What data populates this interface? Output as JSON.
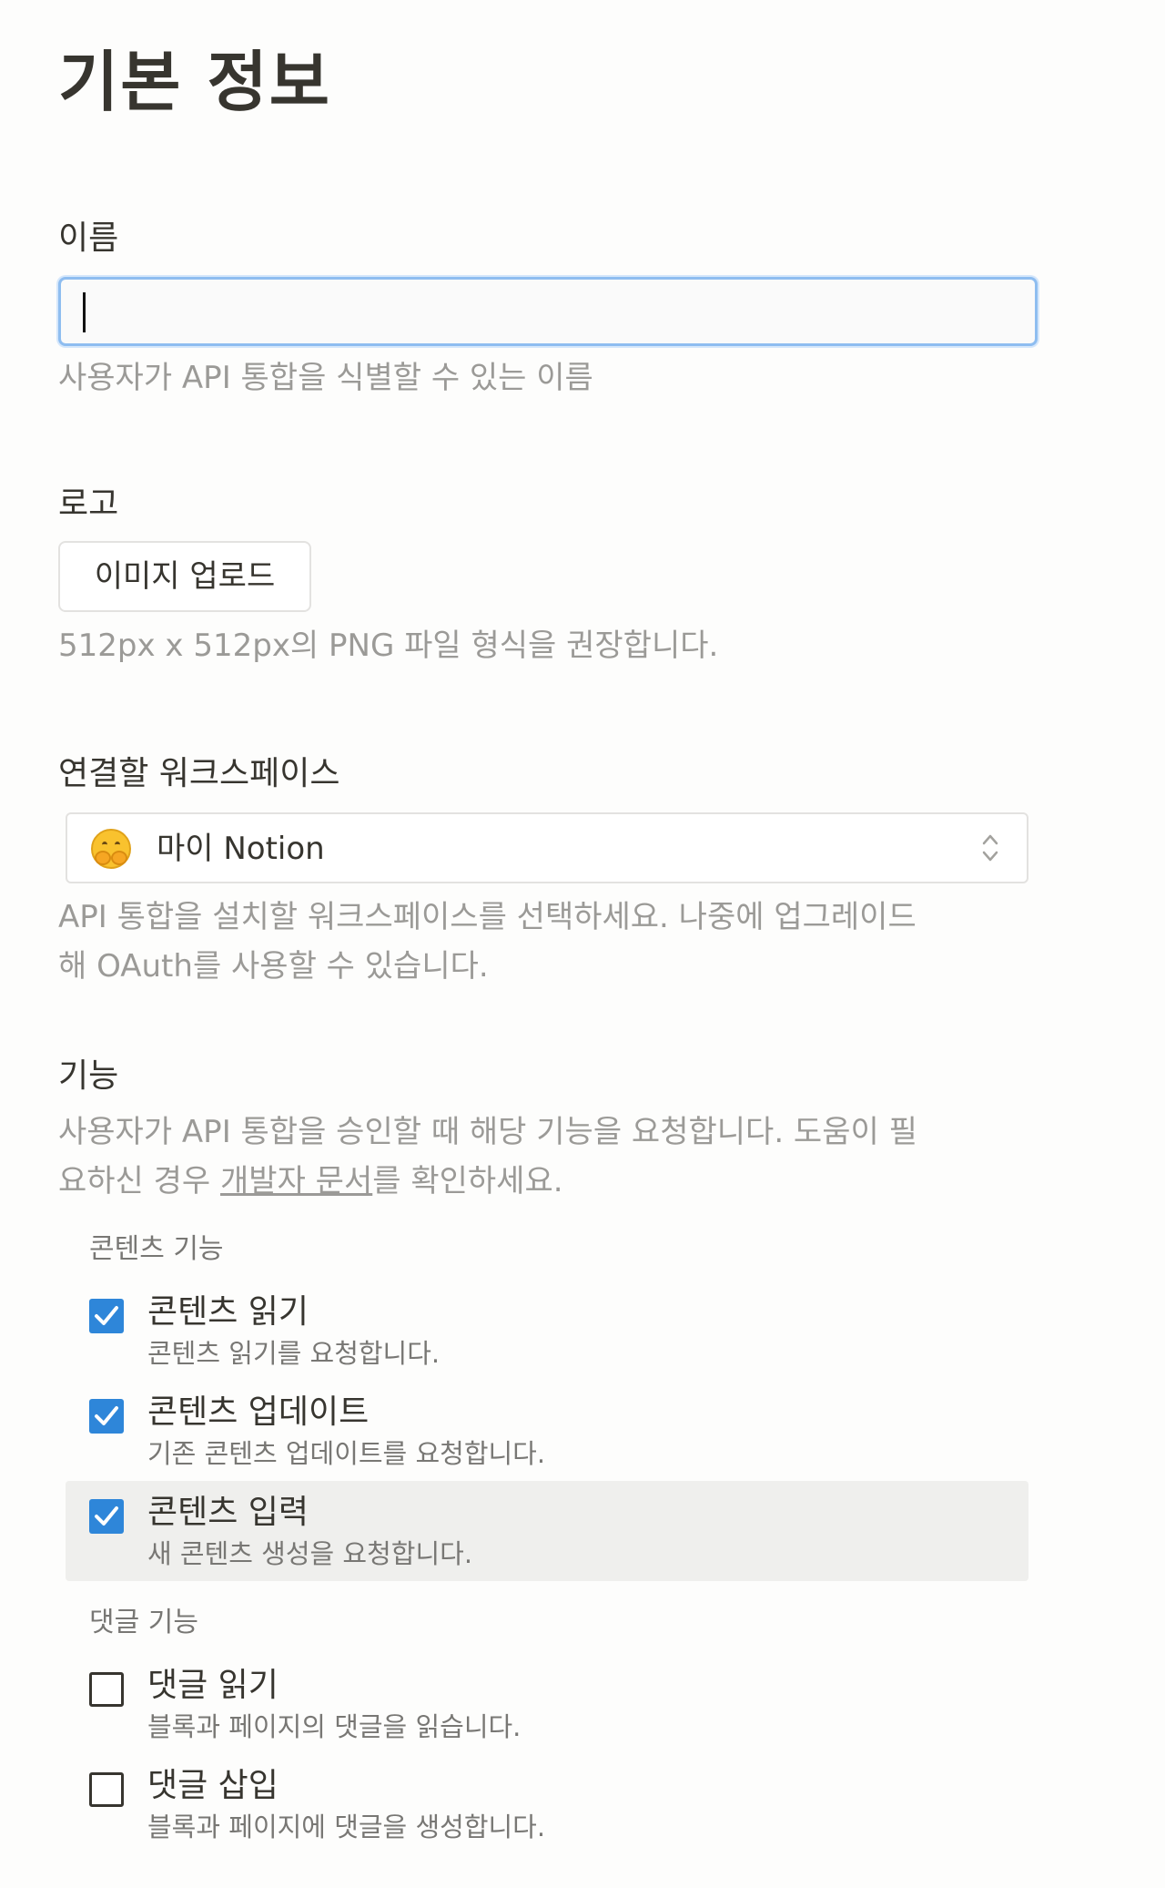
{
  "page": {
    "title": "기본 정보"
  },
  "name": {
    "label": "이름",
    "value": "",
    "help": "사용자가 API 통합을 식별할 수 있는 이름"
  },
  "logo": {
    "label": "로고",
    "upload_button": "이미지 업로드",
    "help": "512px x 512px의 PNG 파일 형식을 권장합니다."
  },
  "workspace": {
    "label": "연결할 워크스페이스",
    "icon": "hugging-face-emoji",
    "selected": "마이 Notion",
    "help_line1": "API 통합을 설치할 워크스페이스를 선택하세요. 나중에 업그레이드",
    "help_line2": "해 OAuth를 사용할 수 있습니다."
  },
  "capabilities": {
    "label": "기능",
    "help_line1": "사용자가 API 통합을 승인할 때 해당 기능을 요청합니다. 도움이 필",
    "help_line2_prefix": "요하신 경우 ",
    "help_link": "개발자 문서",
    "help_line2_suffix": "를 확인하세요.",
    "content_group": {
      "label": "콘텐츠 기능",
      "items": [
        {
          "title": "콘텐츠 읽기",
          "desc": "콘텐츠 읽기를 요청합니다.",
          "checked": true
        },
        {
          "title": "콘텐츠 업데이트",
          "desc": "기존 콘텐츠 업데이트를 요청합니다.",
          "checked": true
        },
        {
          "title": "콘텐츠 입력",
          "desc": "새 콘텐츠 생성을 요청합니다.",
          "checked": true
        }
      ]
    },
    "comment_group": {
      "label": "댓글 기능",
      "items": [
        {
          "title": "댓글 읽기",
          "desc": "블록과 페이지의 댓글을 읽습니다.",
          "checked": false
        },
        {
          "title": "댓글 삽입",
          "desc": "블록과 페이지에 댓글을 생성합니다.",
          "checked": false
        }
      ]
    }
  },
  "colors": {
    "checkbox_accent": "#2e86d9",
    "focus_ring": "#8ebdf0",
    "hover_row": "#efefed"
  }
}
